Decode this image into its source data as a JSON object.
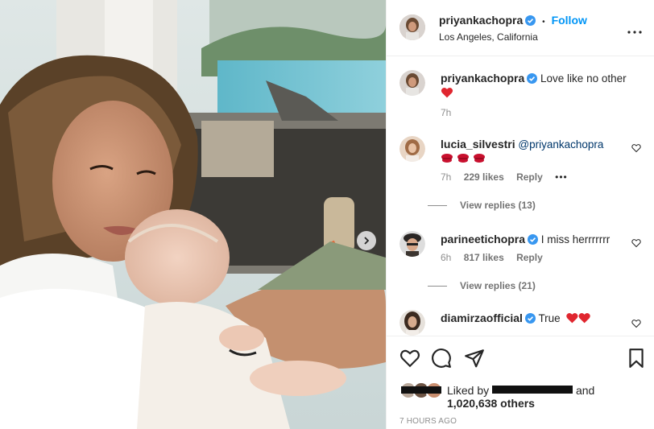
{
  "post": {
    "author": "priyankachopra",
    "separator": "•",
    "follow_label": "Follow",
    "location": "Los Angeles, California",
    "caption_author": "priyankachopra",
    "caption_text": "Love like no other",
    "caption_time": "7h"
  },
  "comments": [
    {
      "user": "lucia_silvestri",
      "text": "@priyankachopra",
      "second_line": "💋💋💋",
      "time": "7h",
      "likes": "229 likes",
      "reply": "Reply",
      "more": "•••",
      "view_replies": "View replies (13)"
    },
    {
      "user": "parineetichopra",
      "text": "I miss herrrrrrr",
      "time": "6h",
      "likes": "817 likes",
      "reply": "Reply",
      "view_replies": "View replies (21)"
    },
    {
      "user": "diamirzaofficial",
      "text": "True"
    }
  ],
  "footer": {
    "liked_prefix": "Liked by",
    "liked_suffix": "and",
    "others": "1,020,638 others",
    "timeago": "7 HOURS AGO"
  },
  "colors": {
    "accent": "#0095f6",
    "verified": "#3897f0",
    "heart": "#ed4956",
    "text": "#262626",
    "muted": "#8e8e8e"
  },
  "icons": {
    "heart": "heart-icon",
    "comment": "comment-icon",
    "share": "share-icon",
    "save": "bookmark-icon",
    "more": "more-options-icon",
    "next": "chevron-right-icon"
  }
}
